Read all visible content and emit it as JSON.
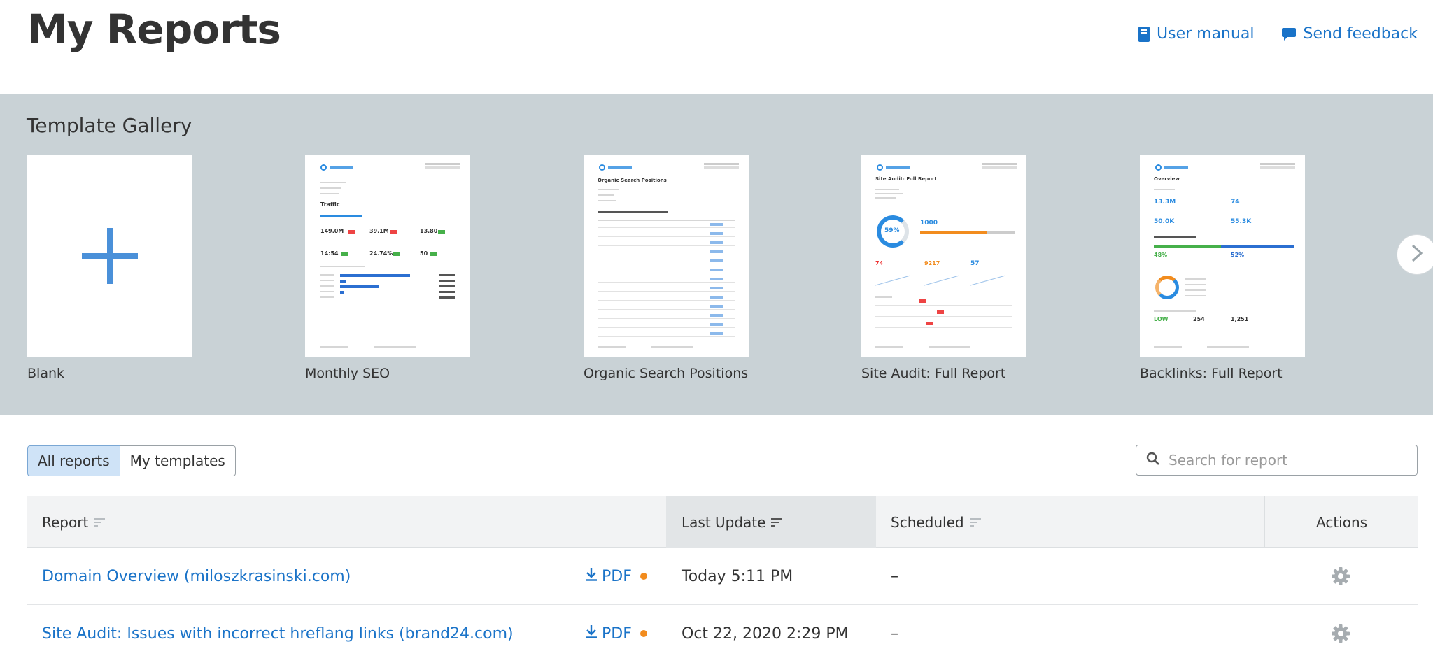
{
  "page": {
    "title": "My Reports"
  },
  "header": {
    "user_manual": "User manual",
    "send_feedback": "Send feedback"
  },
  "gallery": {
    "title": "Template Gallery",
    "templates": [
      {
        "label": "Blank"
      },
      {
        "label": "Monthly SEO"
      },
      {
        "label": "Organic Search Positions"
      },
      {
        "label": "Site Audit: Full Report"
      },
      {
        "label": "Backlinks: Full Report"
      }
    ],
    "thumb_text": {
      "seo_title": "Traffic",
      "seo_v1": "149.0M",
      "seo_v2": "39.1M",
      "seo_v3": "13.80",
      "seo_v4": "14:54",
      "seo_v5": "24.74%",
      "seo_v6": "50",
      "osp_title": "Organic Search Positions",
      "sa_title": "Site Audit: Full Report",
      "sa_score": "59%",
      "sa_crawled": "1000",
      "sa_errors": "74",
      "sa_warnings": "9217",
      "sa_notices": "57",
      "bl_title": "Overview",
      "bl_v1": "13.3M",
      "bl_v2": "74",
      "bl_v3": "50.0K",
      "bl_v4": "55.3K",
      "bl_v5": "48%",
      "bl_v6": "52%",
      "bl_v7": "LOW",
      "bl_v8": "254",
      "bl_v9": "1,251"
    }
  },
  "filters": {
    "tabs": [
      "All reports",
      "My templates"
    ],
    "active_tab": "All reports"
  },
  "search": {
    "placeholder": "Search for report",
    "value": ""
  },
  "table": {
    "columns": [
      "Report",
      "Last Update",
      "Scheduled",
      "Actions"
    ],
    "sorted_column": "Last Update",
    "rows": [
      {
        "report": "Domain Overview (miloszkrasinski.com)",
        "pdf": "PDF",
        "last_update": "Today 5:11 PM",
        "scheduled": "–"
      },
      {
        "report": "Site Audit: Issues with incorrect hreflang links (brand24.com)",
        "pdf": "PDF",
        "last_update": "Oct 22, 2020 2:29 PM",
        "scheduled": "–"
      }
    ]
  },
  "colors": {
    "link": "#1a73c8",
    "gallery_bg": "#c9d2d6",
    "accent_orange": "#f28c1e",
    "active_tab_bg": "#cfe3f7"
  },
  "icons": [
    "book-icon",
    "chat-bubble-icon",
    "plus-icon",
    "chevron-right-icon",
    "search-icon",
    "sort-icon",
    "download-icon",
    "gear-icon"
  ]
}
